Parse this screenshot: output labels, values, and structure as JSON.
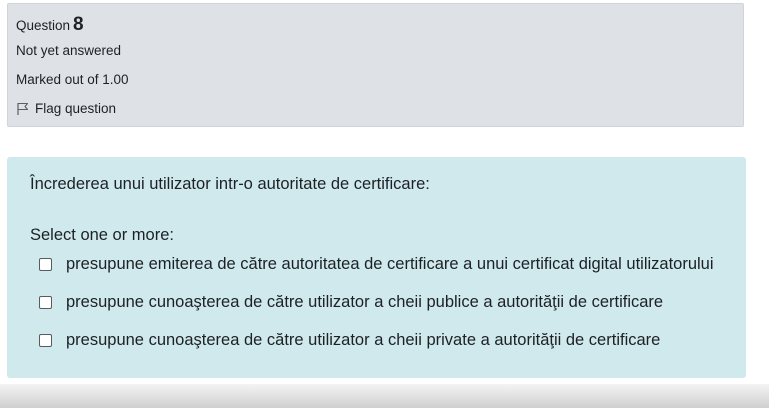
{
  "info": {
    "question_label": "Question",
    "question_number": "8",
    "state": "Not yet answered",
    "grade": "Marked out of 1.00",
    "flag_label": "Flag question"
  },
  "content": {
    "question_text": "Încrederea unui utilizator intr-o autoritate de certificare:",
    "prompt": "Select one or more:",
    "answers": [
      {
        "label": "presupune emiterea de către autoritatea de certificare a unui certificat digital utilizatorului",
        "checked": false
      },
      {
        "label": "presupune cunoaşterea de către utilizator a cheii publice a autorităţii de certificare",
        "checked": false
      },
      {
        "label": "presupune cunoaşterea de către utilizator a cheii private a autorităţii de certificare",
        "checked": false
      }
    ]
  },
  "colors": {
    "info_bg": "#dee2e6",
    "content_bg": "#cfe9ec",
    "text": "#1d2125"
  },
  "icons": {
    "flag": "flag-icon"
  }
}
